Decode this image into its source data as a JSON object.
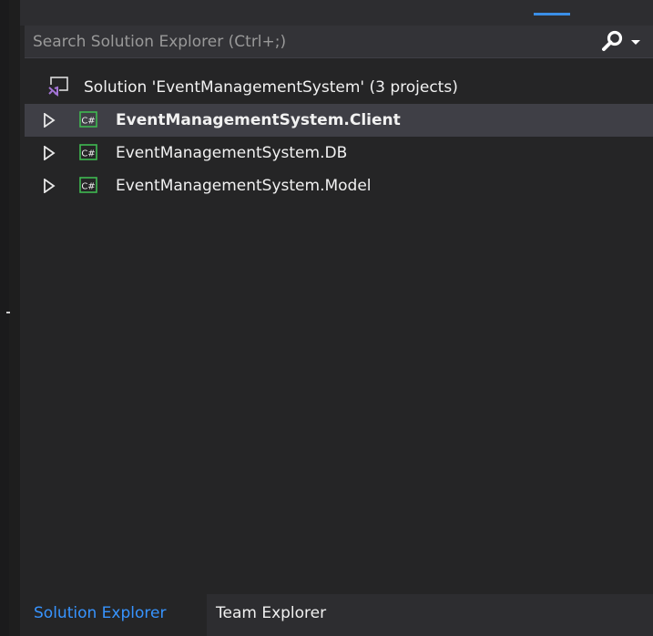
{
  "window": {
    "title": "Solution Explorer"
  },
  "search": {
    "placeholder": "Search Solution Explorer (Ctrl+;)",
    "icon": "search-icon"
  },
  "tree": {
    "solution": {
      "label": "Solution 'EventManagementSystem' (3 projects)",
      "icon": "visual-studio-solution-icon"
    },
    "projects": [
      {
        "label": "EventManagementSystem.Client",
        "icon": "csharp-project-icon",
        "bold": true,
        "selected": true
      },
      {
        "label": "EventManagementSystem.DB",
        "icon": "csharp-project-icon",
        "bold": false,
        "selected": false
      },
      {
        "label": "EventManagementSystem.Model",
        "icon": "csharp-project-icon",
        "bold": false,
        "selected": false
      }
    ]
  },
  "tabs": [
    {
      "label": "Solution Explorer",
      "active": true
    },
    {
      "label": "Team Explorer",
      "active": false
    }
  ],
  "colors": {
    "background": "#252526",
    "selection": "#3f3f46",
    "accent": "#3794ff",
    "text": "#f1f1f1",
    "csharp_icon": "#3fb950",
    "solution_icon": "#a374d5"
  }
}
